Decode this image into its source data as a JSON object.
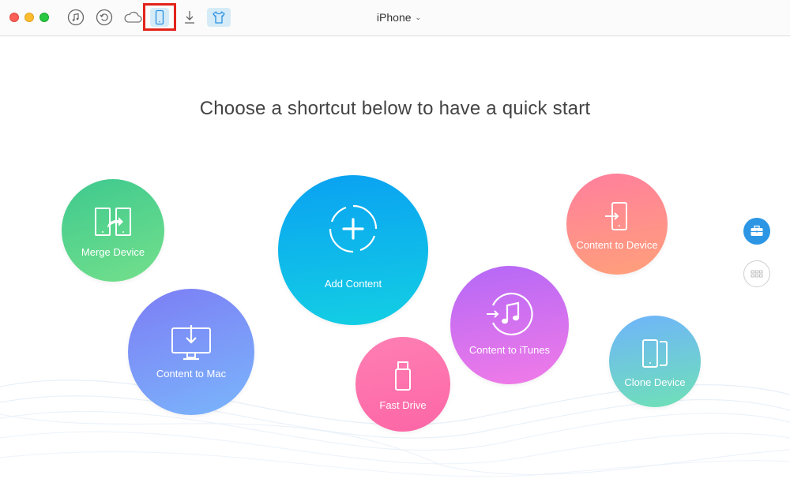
{
  "toolbar": {
    "device_name": "iPhone",
    "buttons": [
      {
        "icon": "itunes-music-icon"
      },
      {
        "icon": "restore-history-icon"
      },
      {
        "icon": "icloud-icon"
      },
      {
        "icon": "iphone-device-icon",
        "selected": true
      },
      {
        "icon": "download-icon"
      },
      {
        "icon": "shirt-theme-icon",
        "active": true
      }
    ]
  },
  "main": {
    "headline": "Choose a shortcut below to have a quick start",
    "shortcuts": {
      "merge_device": "Merge Device",
      "content_to_mac": "Content to Mac",
      "add_content": "Add Content",
      "fast_drive": "Fast Drive",
      "content_to_itunes": "Content to iTunes",
      "content_to_device": "Content to Device",
      "clone_device": "Clone Device"
    }
  },
  "sidebar_right": {
    "buttons": [
      {
        "icon": "toolkit-briefcase-icon",
        "active": true
      },
      {
        "icon": "grid-apps-icon"
      }
    ]
  },
  "colors": {
    "highlight_box": "#e2231a",
    "toolbar_active_bg": "#d5ecf8",
    "accent_blue": "#2c96e4"
  }
}
